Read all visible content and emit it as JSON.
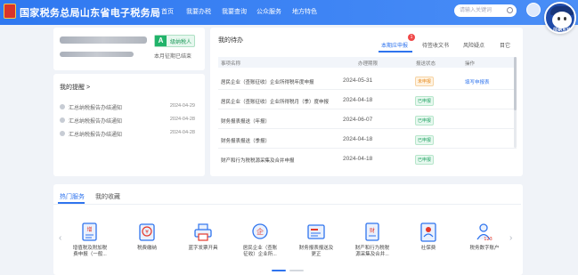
{
  "header": {
    "site_title": "国家税务总局山东省电子税务局",
    "nav": [
      "首页",
      "我要办税",
      "我要查询",
      "公众服务",
      "地方特色"
    ],
    "search_placeholder": "请输入关键词",
    "mascot_label": "征纳互动",
    "accent": "#2f78f0"
  },
  "account": {
    "badge_letter": "A",
    "badge_text": "级纳税人",
    "subtext": "本月征期已结束"
  },
  "reminders": {
    "title": "我的提醒 >",
    "items": [
      {
        "text": "汇总纳税报告办结通知",
        "date": "2024-04-29"
      },
      {
        "text": "汇总纳税报告办结通知",
        "date": "2024-04-28"
      },
      {
        "text": "汇总纳税报告办结通知",
        "date": "2024-04-28"
      }
    ]
  },
  "todo": {
    "title": "我的待办",
    "tabs": [
      "本期应申报",
      "待签收文书",
      "风险疑点",
      "目它"
    ],
    "tab_badge": "1",
    "columns": [
      "事项名称",
      "办理期限",
      "报送状态",
      "操作"
    ],
    "rows": [
      {
        "name": "居民企业（查账征收）企业所得税年度申报",
        "date": "2024-05-31",
        "status": "未申报",
        "status_type": "o",
        "action": "填写申报表"
      },
      {
        "name": "居民企业（查账征收）企业所得税月（季）度申报",
        "date": "2024-04-18",
        "status": "已申报",
        "status_type": "g",
        "action": ""
      },
      {
        "name": "财务报表报送（年报）",
        "date": "2024-06-07",
        "status": "已申报",
        "status_type": "g",
        "action": ""
      },
      {
        "name": "财务报表报送（季报）",
        "date": "2024-04-18",
        "status": "已申报",
        "status_type": "g",
        "action": ""
      },
      {
        "name": "财产和行为税税源采集及合并申报",
        "date": "2024-04-18",
        "status": "已申报",
        "status_type": "g",
        "action": ""
      }
    ]
  },
  "services": {
    "tabs": [
      "热门服务",
      "我的收藏"
    ],
    "items": [
      {
        "label1": "增值税及附加税",
        "label2": "费申报（一般...",
        "icon": "vat-form-icon"
      },
      {
        "label1": "税费缴纳",
        "label2": "",
        "icon": "tax-payment-icon"
      },
      {
        "label1": "蓝字发票开具",
        "label2": "",
        "icon": "invoice-printer-icon"
      },
      {
        "label1": "居民企业（查账",
        "label2": "征收）企业所...",
        "icon": "enterprise-tax-icon"
      },
      {
        "label1": "财务报表报送及",
        "label2": "更正",
        "icon": "financial-report-icon"
      },
      {
        "label1": "财产和行为税税",
        "label2": "源采集及合并...",
        "icon": "property-tax-icon"
      },
      {
        "label1": "社保费",
        "label2": "",
        "icon": "social-security-icon"
      },
      {
        "label1": "税务数字账户",
        "label2": "",
        "icon": "digital-account-icon"
      }
    ]
  }
}
